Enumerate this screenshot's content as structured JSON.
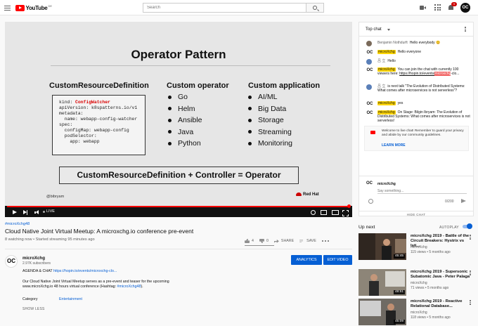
{
  "header": {
    "logo_text": "YouTube",
    "logo_country": "DE",
    "search_placeholder": "Search",
    "notification_count": "9",
    "avatar_text": "OC"
  },
  "slide": {
    "title": "Operator Pattern",
    "col1_heading": "CustomResourceDefinition",
    "col2_heading": "Custom operator",
    "col3_heading": "Custom application",
    "code_kind_key": "kind: ",
    "code_kind_value": "ConfigWatcher",
    "code_rest": "apiVersion: k8spatterns.io/v1\nmetadata:\n  name: webapp-config-watcher\nspec:\n  configMap: webapp-config\n  podSelector:\n    app: webapp",
    "operators": [
      "Go",
      "Helm",
      "Ansible",
      "Java",
      "Python"
    ],
    "applications": [
      "AI/ML",
      "Big Data",
      "Storage",
      "Streaming",
      "Monitoring"
    ],
    "formula": "CustomResourceDefinition + Controller = Operator",
    "handle": "@bibryam",
    "brand": "Red Hat"
  },
  "player": {
    "live_label": "LIVE",
    "progress": 1.0
  },
  "video": {
    "hashtag": "#microXchg48",
    "title": "Cloud Native Joint Virtual Meetup: A microxchg.io conference pre-event",
    "meta": "8 watching now • Started streaming 95 minutes ago",
    "likes": "4",
    "dislikes": "0",
    "share_label": "SHARE",
    "save_label": "SAVE"
  },
  "channel": {
    "avatar_text": "OC",
    "name": "microXchg",
    "subscribers": "2.97K subscribers",
    "analytics_label": "ANALYTICS",
    "edit_label": "EDIT VIDEO"
  },
  "description": {
    "line1_prefix": "AGENDA & CHAT ",
    "line1_link": "https://hopin.to/events/microxchg-clo...",
    "line2": "Our Cloud Native Joint Virtual Meetup serves as a pre-event and teaser for the upcoming",
    "line3_prefix": "www.microXchg.io 48 hours virtual conference (Hashtag: ",
    "line3_tag": "#microXchg48",
    "line3_suffix": ").",
    "category_label": "Category",
    "category_value": "Entertainment",
    "show_less": "SHOW LESS"
  },
  "chat": {
    "title": "Top chat",
    "messages": [
      {
        "author": "Benjamin Nothdurft",
        "text": "Hello everybody 😊"
      },
      {
        "author": "microXchg",
        "text": "Hello everyone"
      },
      {
        "author": "吕 立",
        "text": "Hello"
      },
      {
        "author": "microXchg",
        "text": "You can join the chat with currently 100 viewers here: ",
        "link": "https://hopin.to/events/",
        "hl": "microxchg",
        "tail": "-clo..."
      },
      {
        "author": "吕 立",
        "text": "is next talk \"The Evolution of Distributed Systems: What comes after microservices is not serverless\"?"
      },
      {
        "author": "microXchg",
        "text": "yes"
      },
      {
        "author": "microXchg",
        "text": "On Stage: Bilgin Ibryam: The Evolution of Distributed Systems: What comes after microservices is not serverless!"
      }
    ],
    "notice_text": "Welcome to live chat! Remember to guard your privacy and abide by our community guidelines.",
    "notice_link": "LEARN MORE",
    "input_avatar": "OC",
    "input_user": "microXchg",
    "input_placeholder": "Say something...",
    "char_count": "0/200",
    "hide_label": "HIDE CHAT"
  },
  "upnext": {
    "label": "Up next",
    "autoplay_label": "AUTOPLAY",
    "items": [
      {
        "title": "microXchg 2019 - Battle of the Circuit Breakers: Hystrix vs Isti...",
        "channel": "microXchg",
        "meta": "115 views • 5 months ago",
        "duration": "45:45"
      },
      {
        "title": "microXchg 2019 - Supersonic Subatomic Java - Peter Palaga",
        "channel": "microXchg",
        "meta": "71 views • 5 months ago",
        "duration": "48:51"
      },
      {
        "title": "microXchg 2019 - Reactive Relational Database...",
        "channel": "microXchg",
        "meta": "118 views • 5 months ago",
        "duration": "45:09"
      }
    ]
  }
}
